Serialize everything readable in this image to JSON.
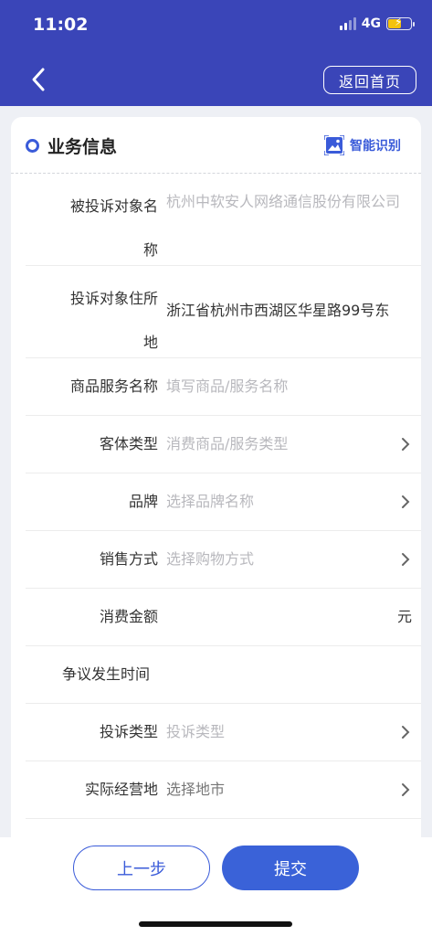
{
  "status": {
    "time": "11:02",
    "network": "4G"
  },
  "nav": {
    "home_label": "返回首页"
  },
  "section": {
    "title": "业务信息",
    "ai_label": "智能识别"
  },
  "rows": [
    {
      "label_line1": "被投诉对象名",
      "label_line2": "称",
      "value": "杭州中软安人网络通信股份有限公司",
      "filled": false
    },
    {
      "label_line1": "投诉对象住所",
      "label_line2": "地",
      "value": "浙江省杭州市西湖区华星路99号东",
      "filled": true
    },
    {
      "label": "商品服务名称",
      "value": "填写商品/服务名称"
    },
    {
      "label": "客体类型",
      "value": "消费商品/服务类型"
    },
    {
      "label": "品牌",
      "value": "选择品牌名称"
    },
    {
      "label": "销售方式",
      "value": "选择购物方式"
    },
    {
      "label": "消费金额",
      "unit": "元"
    },
    {
      "label": "争议发生时间"
    },
    {
      "label": "投诉类型",
      "value": "投诉类型"
    },
    {
      "label": "实际经营地",
      "value": "选择地市"
    }
  ],
  "footer": {
    "prev_label": "上一步",
    "submit_label": "提交"
  },
  "colors": {
    "header": "#3a45b8",
    "accent": "#3a5bd9",
    "button": "#3a62d8"
  }
}
